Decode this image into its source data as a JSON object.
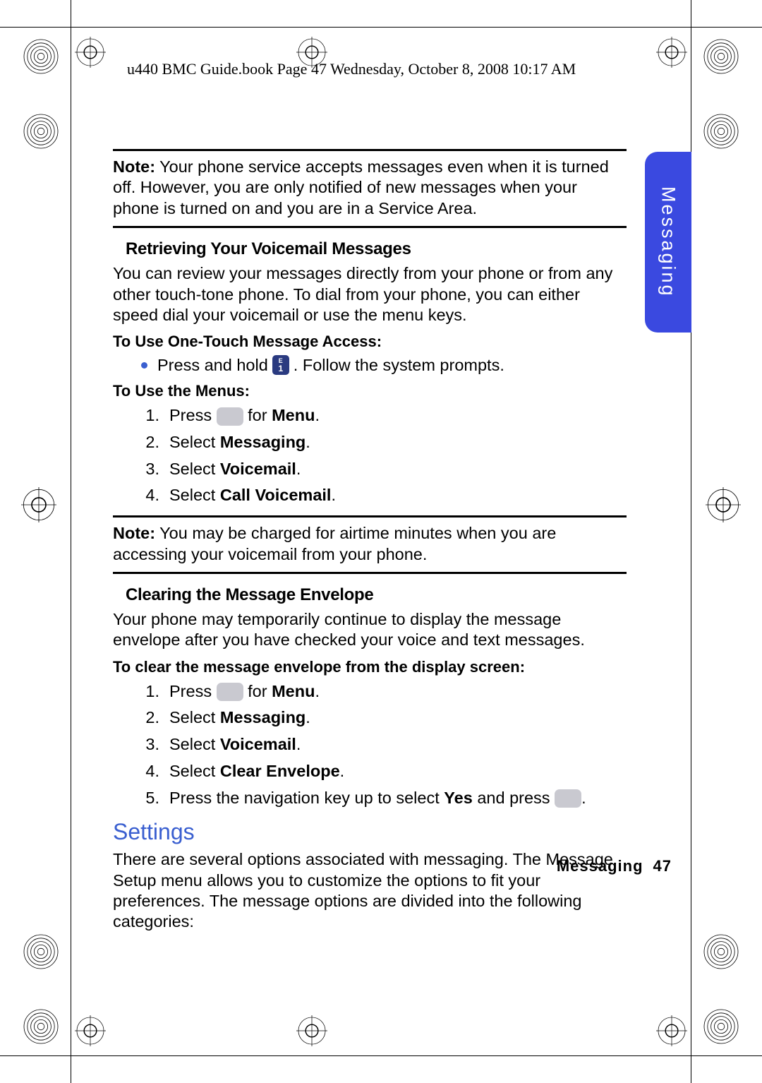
{
  "header": "u440 BMC Guide.book  Page 47  Wednesday, October 8, 2008  10:17 AM",
  "side_tab": "Messaging",
  "note1_label": "Note:",
  "note1_text": " Your phone service accepts messages even when it is turned off. However, you are only notified of new messages when your phone is turned on and you are in a Service Area.",
  "h1": "Retrieving Your Voicemail Messages",
  "p1": "You can review your messages directly from your phone or from any other touch-tone phone. To dial from your phone, you can either speed dial your voicemail or use the menu keys.",
  "proc1": "To Use One-Touch Message Access:",
  "bullet_pre": "Press and hold ",
  "bullet_post": ". Follow the system prompts.",
  "proc2": "To Use the Menus:",
  "list1": {
    "i1a": "Press ",
    "i1b": " for ",
    "i1c": "Menu",
    "i1d": ".",
    "i2a": "Select ",
    "i2b": "Messaging",
    "i2c": ".",
    "i3a": "Select ",
    "i3b": "Voicemail",
    "i3c": ".",
    "i4a": "Select ",
    "i4b": "Call Voicemail",
    "i4c": "."
  },
  "note2_label": "Note:",
  "note2_text": " You may be charged for airtime minutes when you are accessing your voicemail from your phone.",
  "h2": "Clearing the Message Envelope",
  "p2": "Your phone may temporarily continue to display the message envelope after you have checked your voice and text messages.",
  "proc3": "To clear the message envelope from the display screen:",
  "list2": {
    "i1a": "Press ",
    "i1b": " for ",
    "i1c": "Menu",
    "i1d": ".",
    "i2a": "Select ",
    "i2b": "Messaging",
    "i2c": ".",
    "i3a": "Select ",
    "i3b": "Voicemail",
    "i3c": ".",
    "i4a": "Select ",
    "i4b": "Clear Envelope",
    "i4c": ".",
    "i5a": "Press the navigation key up to select ",
    "i5b": "Yes",
    "i5c": " and press ",
    "i5d": "."
  },
  "section": "Settings",
  "p3": "There are several options associated with messaging. The Message Setup menu allows you to customize the options to fit your preferences. The message options are divided into the following categories:",
  "footer_label": "Messaging",
  "footer_page": "47"
}
